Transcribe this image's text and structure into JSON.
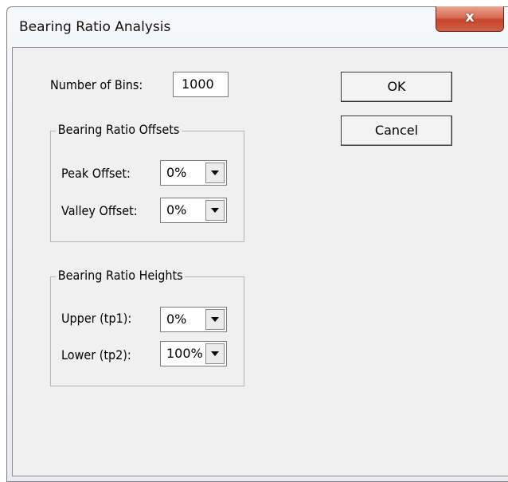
{
  "window": {
    "title": "Bearing Ratio Analysis",
    "close_glyph": "x"
  },
  "bins": {
    "label": "Number of Bins:",
    "value": "1000"
  },
  "buttons": {
    "ok": "OK",
    "cancel": "Cancel"
  },
  "offsets": {
    "group_label": "Bearing Ratio Offsets",
    "peak_label": "Peak Offset:",
    "peak_value": "0%",
    "valley_label": "Valley Offset:",
    "valley_value": "0%"
  },
  "heights": {
    "group_label": "Bearing Ratio Heights",
    "upper_label": "Upper (tp1):",
    "upper_value": "0%",
    "lower_label": "Lower (tp2):",
    "lower_value": "100%"
  },
  "icons": {
    "close": "close-icon",
    "dropdown": "chevron-down-icon"
  },
  "colors": {
    "close_button": "#c4452a",
    "client_bg": "#f0f0f0"
  }
}
